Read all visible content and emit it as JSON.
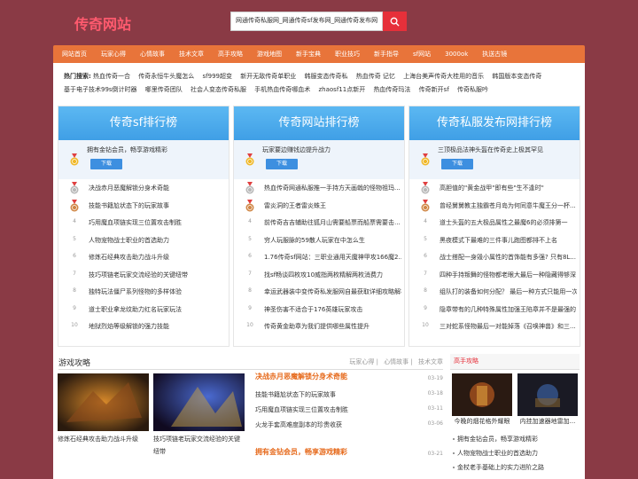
{
  "logo": "传奇网站",
  "search": {
    "value": "网通传奇私服网_网通传奇sf发布网_网通传奇发布网"
  },
  "nav": [
    "网站首页",
    "玩家心得",
    "心情故事",
    "技术文章",
    "高手攻略",
    "游戏地图",
    "新手宝典",
    "职业技巧",
    "新手指导",
    "sf网站",
    "3000ok",
    "执送古镜"
  ],
  "hot": {
    "label": "热门搜索:",
    "items": [
      "热血传奇一合",
      "传奇永恒牛头魔怎么",
      "sf999超变",
      "新开无敌传奇单职业",
      "韩服变态传奇私",
      "热血传奇 记忆",
      "上海台美声传奇大桂用的音乐",
      "韩国版本变态传奇",
      "基于电子技术99s倒计时器",
      "哪里传奇团队",
      "社会人变态传奇私服",
      "手机热血传奇哪血术",
      "zhaosf11点新开",
      "热血传奇玛法",
      "传奇新开sf",
      "传奇私服吟"
    ]
  },
  "ranks": [
    {
      "title": "传奇sf排行榜",
      "top": "拥有金钻会员，畅享游戏精彩",
      "download": "下载",
      "items": [
        "决战赤月恶魔解锁分身术奇能",
        "技能书籍尬状态下的玩家故事",
        "巧用魔血项链实现三位置攻击制胜",
        "人物宠物战士职业的首选助力",
        "修炼石经典攻击助力战斗升级",
        "技巧项链老玩家交流经验的关键纽带",
        "独特玩法僵尸系列怪物的多样体验",
        "道士职业拿龙纹助力红名玩家玩法",
        "地狱烈焰等级解锁的强力技能"
      ]
    },
    {
      "title": "传奇网站排行榜",
      "top": "玩家要边赚钱边提升战力",
      "download": "下载",
      "items": [
        "热血传奇网通私服推一手持方天画戟的怪物祖玛...",
        "雷炎洞的王者雷炎蛛王",
        "前传奇吉吉辅助往狐月山需要船票而船票需要击...",
        "穷人玩服脉的59散人玩家在中怎么生",
        "1.76传奇sf网站：三职业通用天魔神甲攻166魔2...",
        "找sf畅谈四枚攻10威指两枚精解两枚消费力",
        "幸运武器装中变传奇私发服网自最获取详细攻略解析",
        "神圣伤害不适合于176英雄玩家攻击",
        "传奇黄金助章为我们提供哪些属性提升"
      ]
    },
    {
      "title": "传奇私服发布网排行榜",
      "top": "三顶极品法神头盔在传奇史上极其罕见",
      "download": "下载",
      "items": [
        "高胆值的\"黄金战甲\"即有些\"生不逢时\"",
        "曾经舅舅教主独霸苍月岛为何同意牛魔王分一杯...",
        "道士头盔的五大极品属性之最魔6的必须排第一",
        "黑夜模式下最难的三件事儿跑图都排不上名",
        "战士搭配一身毁小属性的首饰能有多强? 只有8L...",
        "四种手持叛舞的怪物都老眼大最后一种隐藏得够深",
        "组队打的装备如何分配？ 最后一种方式只能用一次",
        "隐章带有的几种特殊属性加强王陷章并不是最强的",
        "三对蛇系怪物最后一对能掉落《召唤神兽》和三..."
      ]
    }
  ],
  "section": {
    "title": "游戏攻略",
    "links": [
      "玩家心得",
      "心情故事",
      "技术文章"
    ],
    "pics": [
      {
        "caption": "修炼石经典攻击助力战斗升级"
      },
      {
        "caption": "技巧项链老玩家交流经验的关键纽带"
      }
    ],
    "headline1": {
      "title": "决战赤月恶魔解锁分身术奇能",
      "date": "03-19"
    },
    "news": [
      {
        "title": "技能书籍尬状态下的玩家故事",
        "date": "03-18"
      },
      {
        "title": "巧用魔血项链实现三位置攻击制胜",
        "date": "03-11"
      },
      {
        "title": "火龙手套高难度副本的珍贵收获",
        "date": "03-06"
      }
    ],
    "headline2": {
      "title": "拥有金钻会员，畅享游戏精彩",
      "date": "03-21"
    },
    "extra_dates": [
      "03-19",
      "03-06"
    ]
  },
  "side": {
    "title": "高手攻略",
    "pics": [
      {
        "caption": "今晚的烟花格外耀眼"
      },
      {
        "caption": "内挂加速器地雷加..."
      }
    ],
    "list": [
      "拥有金钻会员，畅享游戏精彩",
      "人物宠物战士职业的首选助力",
      "金杖老手基础上的实力进阶之路"
    ]
  }
}
